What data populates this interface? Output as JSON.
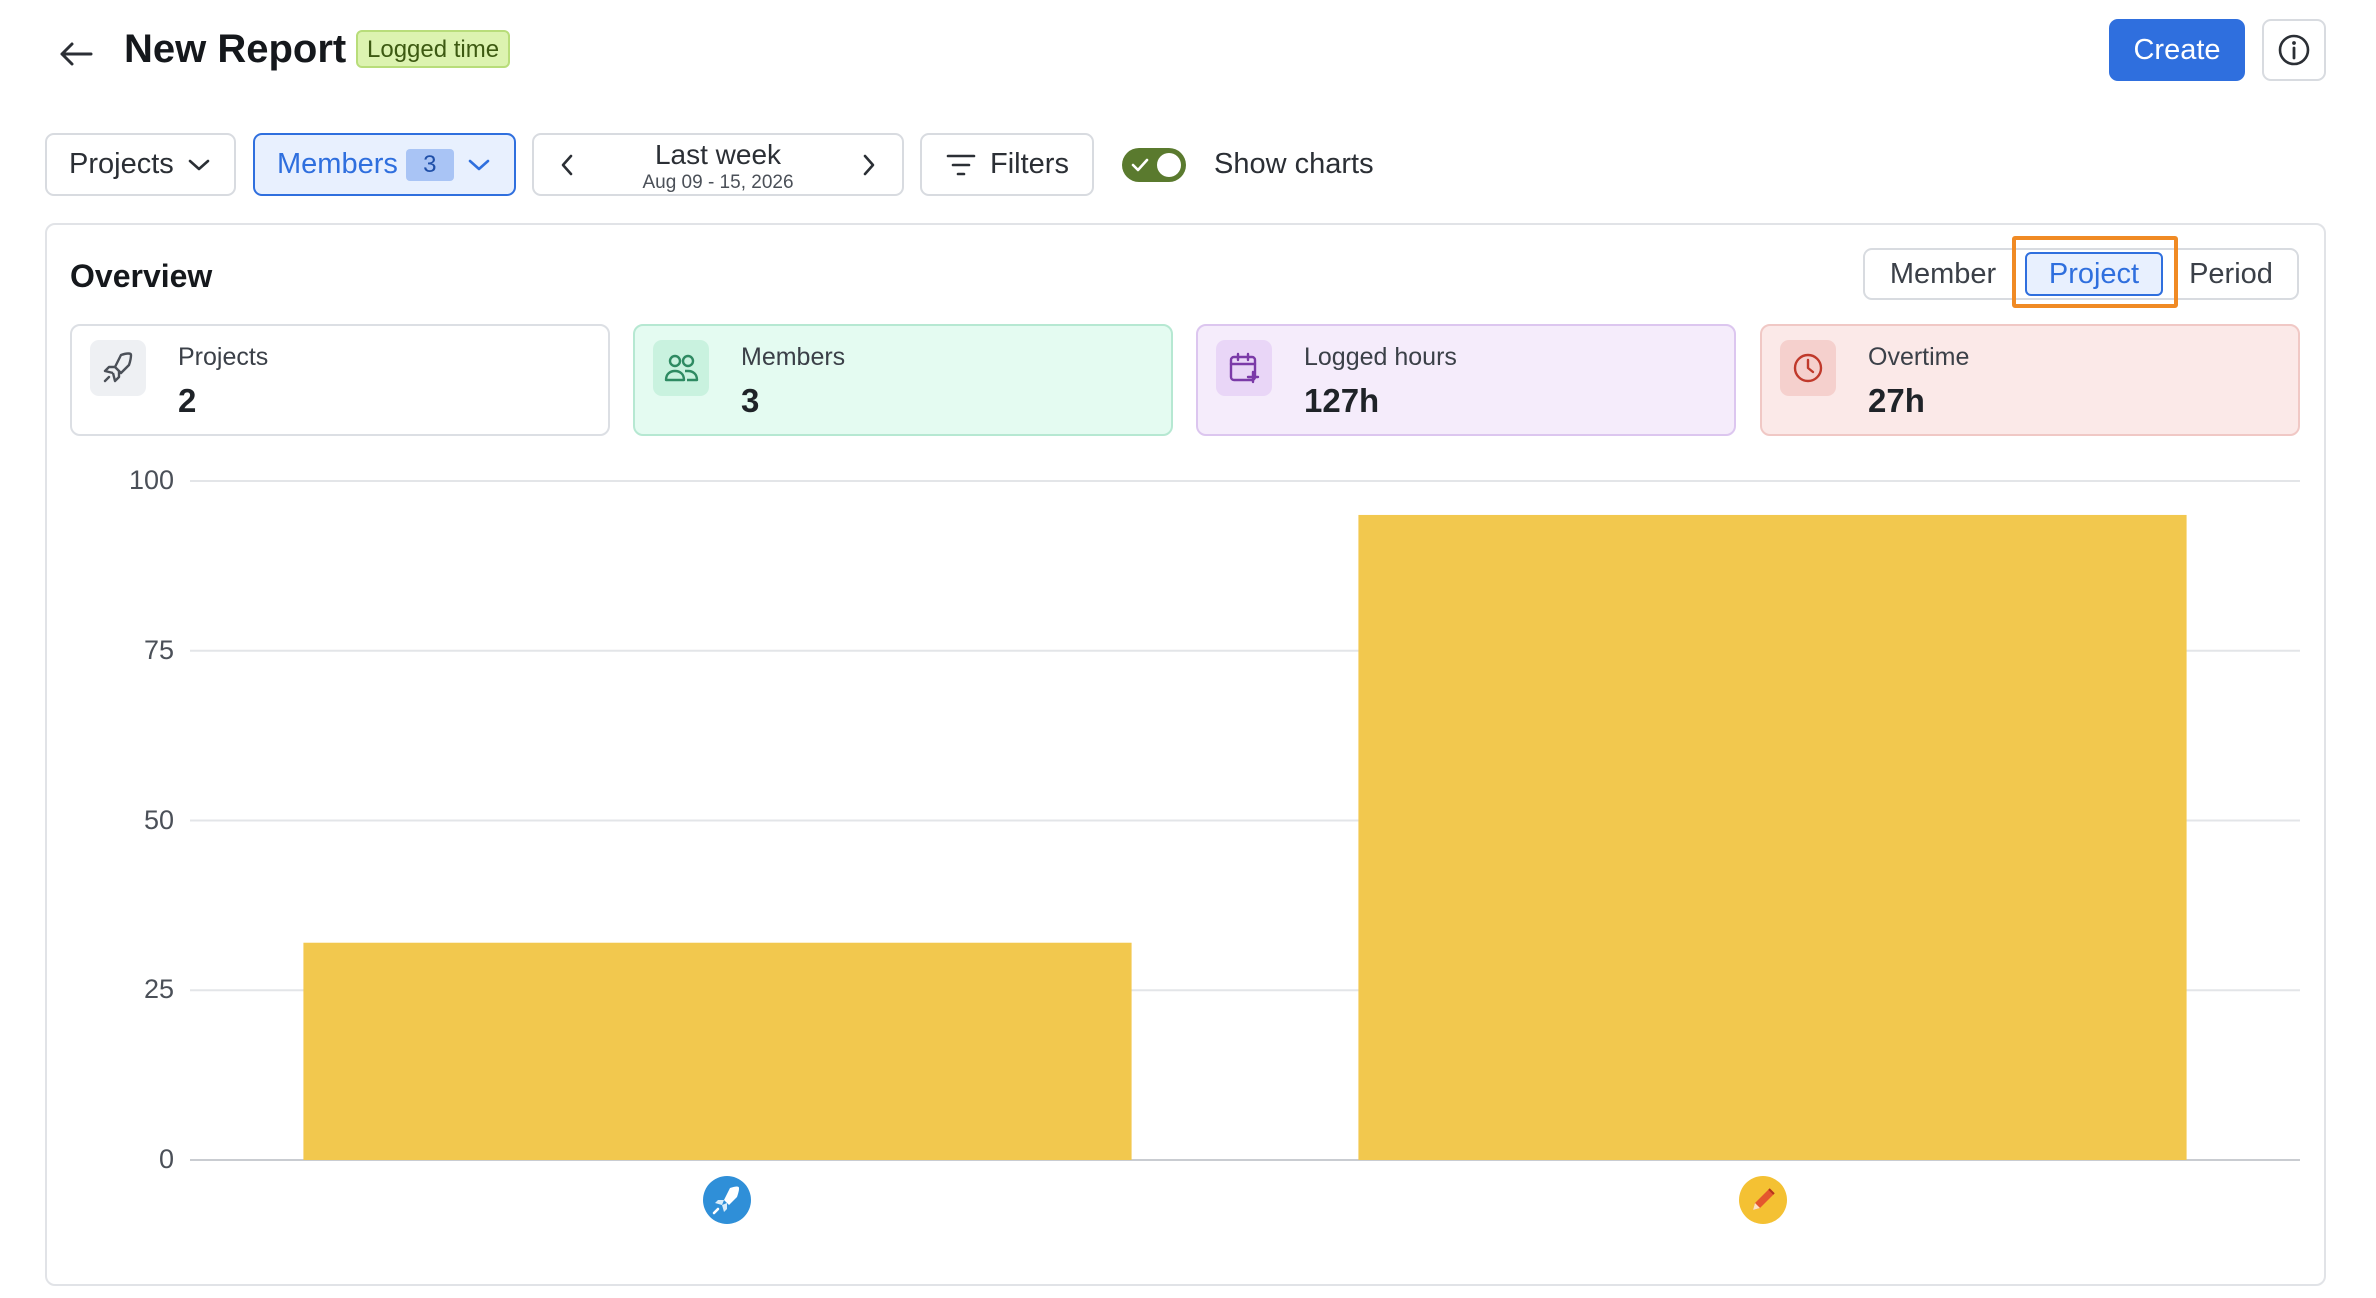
{
  "header": {
    "title": "New Report",
    "badge": "Logged time",
    "create_label": "Create"
  },
  "toolbar": {
    "projects_label": "Projects",
    "members_label": "Members",
    "members_count": "3",
    "period_label": "Last week",
    "period_range": "Aug 09 - 15, 2026",
    "filters_label": "Filters",
    "show_charts_label": "Show charts",
    "show_charts_on": true
  },
  "overview": {
    "title": "Overview",
    "group_by": [
      {
        "label": "Member",
        "selected": false
      },
      {
        "label": "Project",
        "selected": true
      },
      {
        "label": "Period",
        "selected": false
      }
    ],
    "cards": [
      {
        "label": "Projects",
        "value": "2",
        "icon": "rocket-icon",
        "bg": "#ffffff",
        "border": "#dcdfe4",
        "badge_bg": "#eef0f3",
        "icon_color": "#4b5058"
      },
      {
        "label": "Members",
        "value": "3",
        "icon": "users-icon",
        "bg": "#e4fbf1",
        "border": "#b6e8d2",
        "badge_bg": "#c9f2df",
        "icon_color": "#2e8a62"
      },
      {
        "label": "Logged hours",
        "value": "127h",
        "icon": "calendar-plus-icon",
        "bg": "#f5ecfb",
        "border": "#dcc6ef",
        "badge_bg": "#e9d6f7",
        "icon_color": "#7b3aa8"
      },
      {
        "label": "Overtime",
        "value": "27h",
        "icon": "clock-icon",
        "bg": "#fbe9e8",
        "border": "#f0c8c5",
        "badge_bg": "#f5d0cd",
        "icon_color": "#c0392b"
      }
    ]
  },
  "colors": {
    "primary": "#2f6fde",
    "bar": "#f2c84e",
    "toggle_on": "#5a7a2e",
    "highlight": "#f08a24"
  },
  "chart_data": {
    "type": "bar",
    "categories": [
      "rocket-project-icon",
      "pencil-project-icon"
    ],
    "values": [
      32,
      95
    ],
    "ylim": [
      0,
      100
    ],
    "yticks": [
      0,
      25,
      50,
      75,
      100
    ],
    "grid": true,
    "xlabel": "",
    "ylabel": ""
  }
}
